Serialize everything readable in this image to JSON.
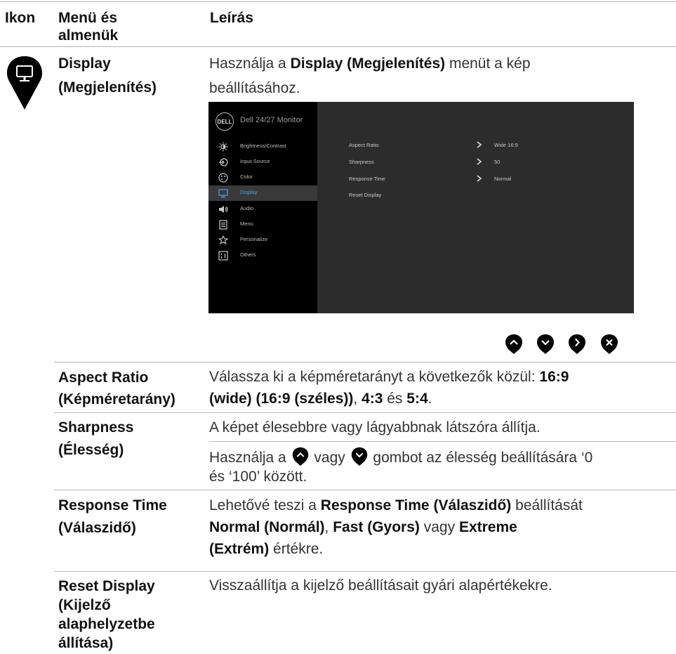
{
  "header": {
    "col_icon": "Ikon",
    "col_menu_line1": "Menü és",
    "col_menu_line2": "almenük",
    "col_desc": "Leírás"
  },
  "display": {
    "icon": "display-pin-icon",
    "menu_line1": "Display",
    "menu_line2": "(Megjelenítés)",
    "desc_pre": "Használja a ",
    "desc_bold": "Display (Megjelenítés)",
    "desc_mid": " menüt a kép",
    "desc_line2": "beállításához."
  },
  "osd": {
    "logo": "DELL",
    "title": "Dell 24/27 Monitor",
    "menu": [
      {
        "icon": "brightness-icon",
        "label": "Brightness/Contrast",
        "active": false
      },
      {
        "icon": "input-source-icon",
        "label": "Input Source",
        "active": false
      },
      {
        "icon": "color-icon",
        "label": "Color",
        "active": false
      },
      {
        "icon": "display-icon",
        "label": "Display",
        "active": true
      },
      {
        "icon": "audio-icon",
        "label": "Audio",
        "active": false
      },
      {
        "icon": "menu-icon",
        "label": "Menu",
        "active": false
      },
      {
        "icon": "personalize-star-icon",
        "label": "Personalize",
        "active": false
      },
      {
        "icon": "others-icon",
        "label": "Others",
        "active": false
      }
    ],
    "settings": [
      {
        "label": "Aspect Ratio",
        "value": "Wide 16:9"
      },
      {
        "label": "Sharpness",
        "value": "50"
      },
      {
        "label": "Response Time",
        "value": "Normal"
      },
      {
        "label": "Reset Display",
        "value": ""
      }
    ],
    "nav_buttons": [
      "up-button-icon",
      "down-button-icon",
      "right-button-icon",
      "close-button-icon"
    ]
  },
  "rows": {
    "aspect": {
      "menu_line1": "Aspect Ratio",
      "menu_line2": "(Képméretarány)",
      "line1_pre": "Válassza ki a képméretarányt a következők közül: ",
      "line1_bold": "16:9",
      "line2_bold1": "(wide) (16:9 (széles))",
      "line2_t1": ", ",
      "line2_bold2": "4:3",
      "line2_t2": " és ",
      "line2_bold3": "5:4",
      "line2_t3": "."
    },
    "sharpness": {
      "menu_line1": "Sharpness",
      "menu_line2": "(Élesség)",
      "desc1": "A képet élesebbre vagy lágyabbnak látszóra állítja.",
      "desc2_pre": "Használja a ",
      "desc2_mid": " vagy ",
      "desc2_post": " gombot az élesség beállítására ‘0",
      "desc3": "és ‘100’ között."
    },
    "response": {
      "menu_line1": "Response Time",
      "menu_line2": "(Válaszidő)",
      "l1_pre": "Lehetővé teszi a ",
      "l1_bold": "Response Time (Válaszidő)",
      "l1_post": " beállítását",
      "l2_bold1": "Normal (Normál)",
      "l2_t1": ", ",
      "l2_bold2": "Fast (Gyors)",
      "l2_t2": " vagy ",
      "l2_bold3": "Extreme",
      "l3_bold": "(Extrém)",
      "l3_post": " értékre."
    },
    "reset": {
      "menu_line1": "Reset Display",
      "menu_line2": "(Kijelző",
      "menu_line3": "alaphelyzetbe",
      "menu_line4": "állítása)",
      "desc": "Visszaállítja a kijelző beállításait gyári alapértékekre."
    }
  }
}
